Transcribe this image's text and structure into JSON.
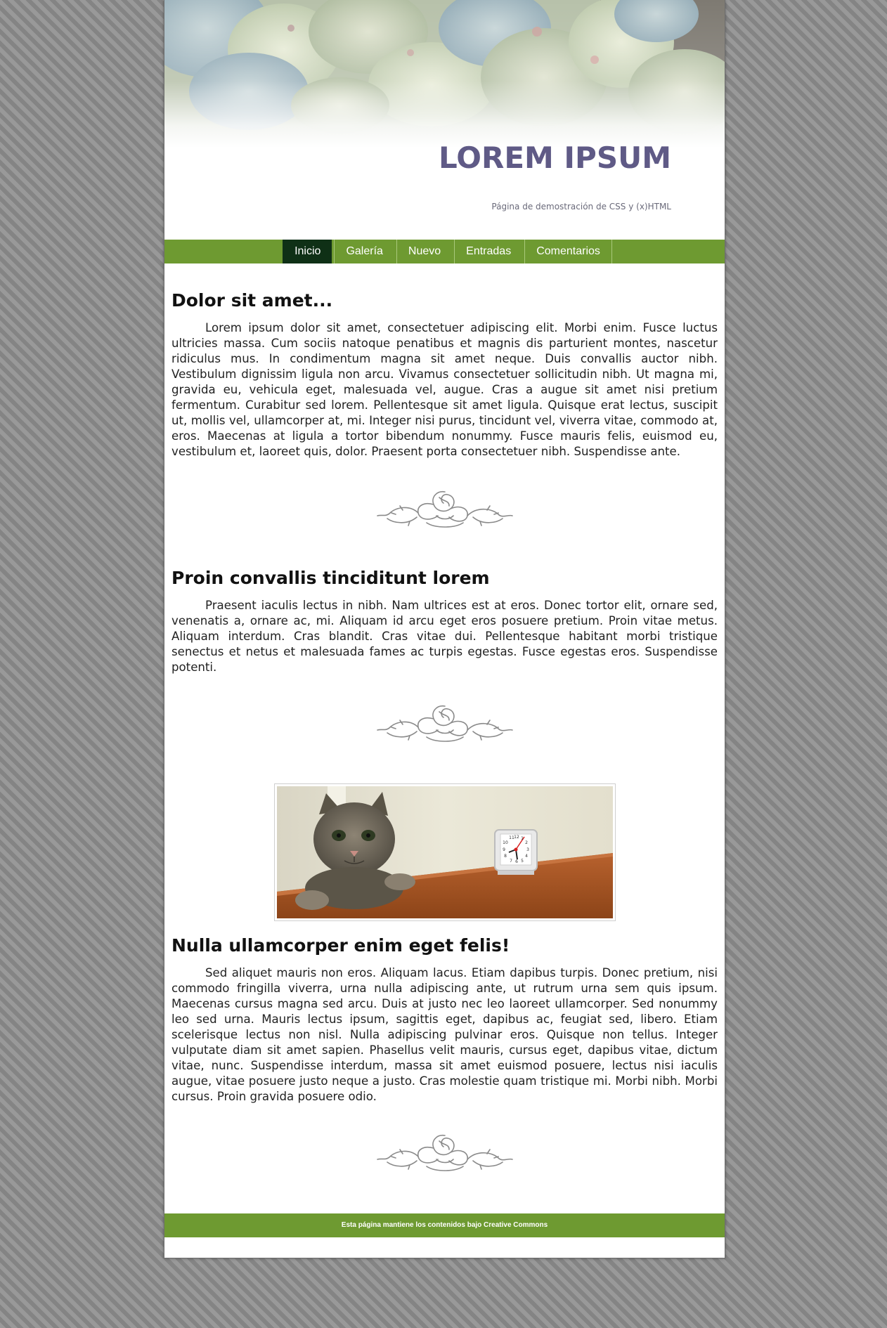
{
  "header": {
    "title": "LOREM IPSUM",
    "subtitle": "Página de demostración de CSS y (x)HTML"
  },
  "nav": {
    "items": [
      {
        "label": "Inicio",
        "active": true
      },
      {
        "label": "Galería",
        "active": false
      },
      {
        "label": "Nuevo",
        "active": false
      },
      {
        "label": "Entradas",
        "active": false
      },
      {
        "label": "Comentarios",
        "active": false
      }
    ]
  },
  "posts": [
    {
      "title": "Dolor sit amet...",
      "body": "Lorem ipsum dolor sit amet, consectetuer adipiscing elit. Morbi enim. Fusce luctus ultricies massa. Cum sociis natoque penatibus et magnis dis parturient montes, nascetur ridiculus mus. In condimentum magna sit amet neque. Duis convallis auctor nibh. Vestibulum dignissim ligula non arcu. Vivamus consectetuer sollicitudin nibh. Ut magna mi, gravida eu, vehicula eget, malesuada vel, augue. Cras a augue sit amet nisi pretium fermentum. Curabitur sed lorem. Pellentesque sit amet ligula. Quisque erat lectus, suscipit ut, mollis vel, ullamcorper at, mi. Integer nisi purus, tincidunt vel, viverra vitae, commodo at, eros. Maecenas at ligula a tortor bibendum nonummy. Fusce mauris felis, euismod eu, vestibulum et, laoreet quis, dolor. Praesent porta consectetuer nibh. Suspendisse ante."
    },
    {
      "title": "Proin convallis tinciditunt lorem",
      "body": "Praesent iaculis lectus in nibh. Nam ultrices est at eros. Donec tortor elit, ornare sed, venenatis a, ornare ac, mi. Aliquam id arcu eget eros posuere pretium. Proin vitae metus. Aliquam interdum. Cras blandit. Cras vitae dui. Pellentesque habitant morbi tristique senectus et netus et malesuada fames ac turpis egestas. Fusce egestas eros. Suspendisse potenti."
    },
    {
      "title": "Nulla ullamcorper enim eget felis!",
      "body": "Sed aliquet mauris non eros. Aliquam lacus. Etiam dapibus turpis. Donec pretium, nisi commodo fringilla viverra, urna nulla adipiscing ante, ut rutrum urna sem quis ipsum. Maecenas cursus magna sed arcu. Duis at justo nec leo laoreet ullamcorper. Sed nonummy leo sed urna. Mauris lectus ipsum, sagittis eget, dapibus ac, feugiat sed, libero. Etiam scelerisque lectus non nisl. Nulla adipiscing pulvinar eros. Quisque non tellus. Integer vulputate diam sit amet sapien. Phasellus velit mauris, cursus eget, dapibus vitae, dictum vitae, nunc. Suspendisse interdum, massa sit amet euismod posuere, lectus nisi iaculis augue, vitae posuere justo neque a justo. Cras molestie quam tristique mi. Morbi nibh. Morbi cursus. Proin gravida posuere odio."
    }
  ],
  "photo": {
    "clock_numbers": [
      "11",
      "12",
      "1",
      "10",
      "2",
      "9",
      "3",
      "8",
      "4",
      "7",
      "6",
      "5"
    ]
  },
  "footer": {
    "text": "Esta página mantiene los contenidos bajo Creative Commons"
  },
  "colors": {
    "nav_bg": "#6e9a31",
    "nav_active": "#0f3016",
    "title": "#5f5a86",
    "page_bg": "#8c8c8c"
  }
}
